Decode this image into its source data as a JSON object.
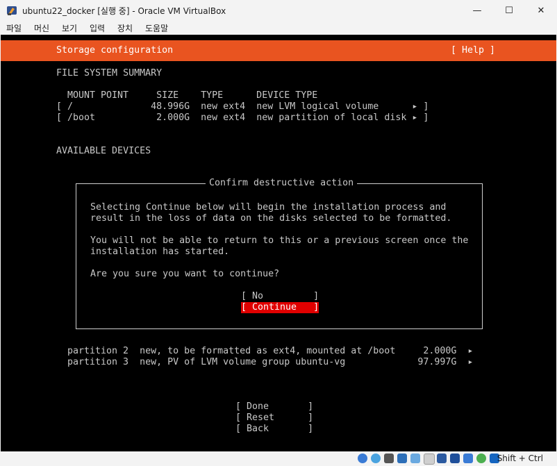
{
  "window": {
    "title": "ubuntu22_docker [실행 중] - Oracle VM VirtualBox",
    "minimize": "—",
    "maximize": "☐",
    "close": "✕"
  },
  "menu": [
    "파일",
    "머신",
    "보기",
    "입력",
    "장치",
    "도움말"
  ],
  "header": {
    "title": "Storage configuration",
    "help": "[ Help ]"
  },
  "summary": {
    "heading": "FILE SYSTEM SUMMARY",
    "columns": "MOUNT POINT     SIZE    TYPE      DEVICE TYPE",
    "rows": [
      "[ /              48.996G  new ext4  new LVM logical volume      ▸ ]",
      "[ /boot           2.000G  new ext4  new partition of local disk ▸ ]"
    ]
  },
  "devices_heading": "AVAILABLE DEVICES",
  "dialog": {
    "title": "Confirm destructive action",
    "p1_l1": "Selecting Continue below will begin the installation process and",
    "p1_l2": "result in the loss of data on the disks selected to be formatted.",
    "p2_l1": "You will not be able to return to this or a previous screen once the",
    "p2_l2": "installation has started.",
    "question": "Are you sure you want to continue?",
    "no": "[ No         ]",
    "continue": "[ Continue   ]"
  },
  "partitions": [
    "partition 2  new, to be formatted as ext4, mounted at /boot     2.000G  ▸",
    "partition 3  new, PV of LVM volume group ubuntu-vg             97.997G  ▸"
  ],
  "actions": {
    "done": "[ Done       ]",
    "reset": "[ Reset      ]",
    "back": "[ Back       ]"
  },
  "statusbar": {
    "host_key": "Shift + Ctrl",
    "icons": [
      "hard-disk-icon",
      "optical-drive-icon",
      "audio-icon",
      "network-icon",
      "usb-icon",
      "shared-folder-icon",
      "display-icon",
      "screen-capture-icon",
      "recording-icon",
      "cpu-icon",
      "mouse-integration-icon",
      "keyboard-icon"
    ]
  }
}
